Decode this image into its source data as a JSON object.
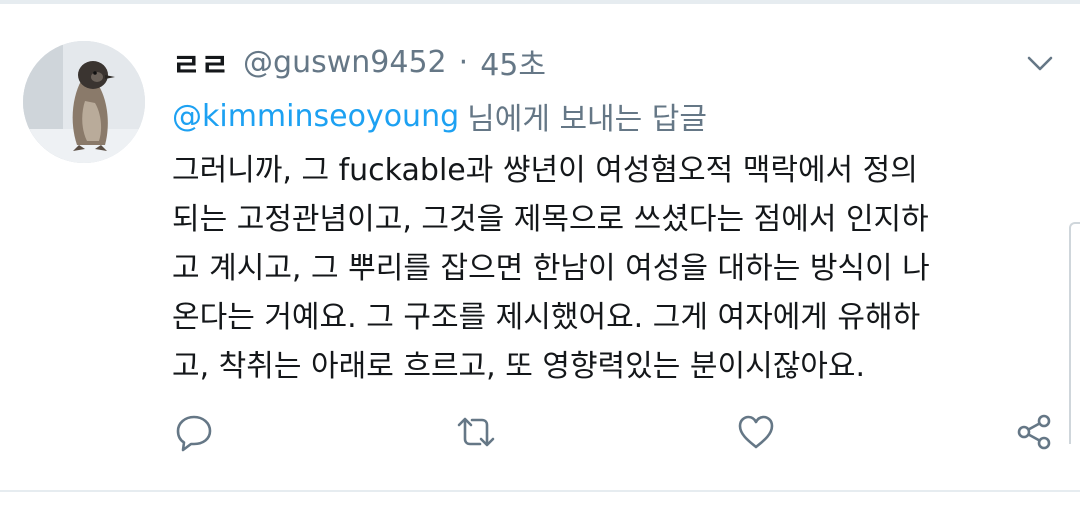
{
  "tweet": {
    "display_name": "ㄹㄹ",
    "handle": "@guswn9452",
    "separator": "·",
    "time": "45초",
    "reply_to": {
      "mention": "@kimminseoyoung",
      "suffix": "님에게 보내는 답글"
    },
    "text_lines": [
      "그러니까, 그 fuckable과 썅년이 여성혐오적 맥락에서 정의",
      "되는 고정관념이고, 그것을 제목으로 쓰셨다는 점에서 인지하",
      "고 계시고, 그 뿌리를 잡으면 한남이 여성을 대하는 방식이 나",
      "온다는 거예요. 그 구조를 제시했어요. 그게 여자에게 유해하",
      "고, 착취는 아래로 흐르고, 또 영향력있는 분이시잖아요."
    ]
  },
  "icons": {
    "menu": "chevron-down-icon",
    "reply": "reply-icon",
    "retweet": "retweet-icon",
    "like": "heart-icon",
    "share": "share-icon"
  },
  "colors": {
    "link": "#1da1f2",
    "secondary_text": "#657786",
    "primary_text": "#14171a",
    "divider": "#e6ecf0"
  }
}
